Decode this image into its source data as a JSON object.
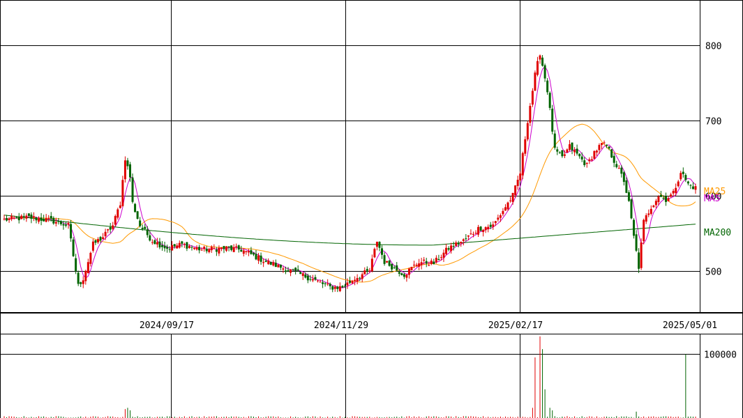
{
  "chart_data": [
    {
      "type": "candlestick",
      "title": "",
      "date_labels": [
        "2024/09/17",
        "2024/11/29",
        "2025/02/17",
        "2025/05/01"
      ],
      "ylim": [
        445,
        860
      ],
      "y_ticks": [
        500,
        600,
        700,
        800
      ],
      "grid": true,
      "colors": {
        "up": "#e00000",
        "down": "#006400"
      },
      "ohlc_keypoints": [
        {
          "i": 0,
          "p": 568
        },
        {
          "i": 10,
          "p": 571
        },
        {
          "i": 20,
          "p": 566
        },
        {
          "i": 26,
          "p": 560
        },
        {
          "i": 30,
          "p": 480
        },
        {
          "i": 32,
          "p": 490
        },
        {
          "i": 36,
          "p": 535
        },
        {
          "i": 40,
          "p": 545
        },
        {
          "i": 44,
          "p": 560
        },
        {
          "i": 47,
          "p": 590
        },
        {
          "i": 49,
          "p": 650
        },
        {
          "i": 51,
          "p": 625
        },
        {
          "i": 52,
          "p": 590
        },
        {
          "i": 55,
          "p": 560
        },
        {
          "i": 60,
          "p": 540
        },
        {
          "i": 66,
          "p": 530
        },
        {
          "i": 72,
          "p": 535
        },
        {
          "i": 80,
          "p": 528
        },
        {
          "i": 90,
          "p": 530
        },
        {
          "i": 96,
          "p": 528
        },
        {
          "i": 106,
          "p": 512
        },
        {
          "i": 116,
          "p": 500
        },
        {
          "i": 124,
          "p": 490
        },
        {
          "i": 132,
          "p": 478
        },
        {
          "i": 137,
          "p": 478
        },
        {
          "i": 142,
          "p": 490
        },
        {
          "i": 148,
          "p": 500
        },
        {
          "i": 151,
          "p": 540
        },
        {
          "i": 154,
          "p": 512
        },
        {
          "i": 162,
          "p": 495
        },
        {
          "i": 168,
          "p": 512
        },
        {
          "i": 174,
          "p": 510
        },
        {
          "i": 180,
          "p": 530
        },
        {
          "i": 186,
          "p": 540
        },
        {
          "i": 192,
          "p": 556
        },
        {
          "i": 198,
          "p": 560
        },
        {
          "i": 204,
          "p": 590
        },
        {
          "i": 206,
          "p": 600
        },
        {
          "i": 209,
          "p": 630
        },
        {
          "i": 212,
          "p": 700
        },
        {
          "i": 215,
          "p": 760
        },
        {
          "i": 217,
          "p": 790
        },
        {
          "i": 220,
          "p": 740
        },
        {
          "i": 223,
          "p": 660
        },
        {
          "i": 226,
          "p": 650
        },
        {
          "i": 229,
          "p": 665
        },
        {
          "i": 232,
          "p": 655
        },
        {
          "i": 236,
          "p": 640
        },
        {
          "i": 239,
          "p": 658
        },
        {
          "i": 242,
          "p": 668
        },
        {
          "i": 244,
          "p": 666
        },
        {
          "i": 248,
          "p": 640
        },
        {
          "i": 251,
          "p": 620
        },
        {
          "i": 253,
          "p": 590
        },
        {
          "i": 255,
          "p": 545
        },
        {
          "i": 257,
          "p": 505
        },
        {
          "i": 259,
          "p": 565
        },
        {
          "i": 262,
          "p": 585
        },
        {
          "i": 265,
          "p": 600
        },
        {
          "i": 268,
          "p": 595
        },
        {
          "i": 271,
          "p": 603
        },
        {
          "i": 274,
          "p": 632
        },
        {
          "i": 277,
          "p": 615
        },
        {
          "i": 280,
          "p": 610
        }
      ],
      "ma_lines": [
        {
          "name": "MA25",
          "color": "#ff9900",
          "end_value": 602
        },
        {
          "name": "MA5",
          "color": "#cc00cc",
          "end_value": 605
        },
        {
          "name": "MA200",
          "color": "#006400",
          "end_value": 552
        }
      ]
    },
    {
      "type": "bar",
      "title": "",
      "y_ticks": [
        100000
      ],
      "ylim": [
        0,
        130000
      ],
      "grid": true,
      "volume_spikes": [
        {
          "i": 49,
          "v": 14000
        },
        {
          "i": 50,
          "v": 16000
        },
        {
          "i": 51,
          "v": 12000
        },
        {
          "i": 214,
          "v": 16000
        },
        {
          "i": 215,
          "v": 95000
        },
        {
          "i": 217,
          "v": 128000
        },
        {
          "i": 218,
          "v": 108000
        },
        {
          "i": 219,
          "v": 45000
        },
        {
          "i": 221,
          "v": 16000
        },
        {
          "i": 222,
          "v": 12000
        },
        {
          "i": 256,
          "v": 10000
        },
        {
          "i": 276,
          "v": 100000
        }
      ]
    }
  ]
}
